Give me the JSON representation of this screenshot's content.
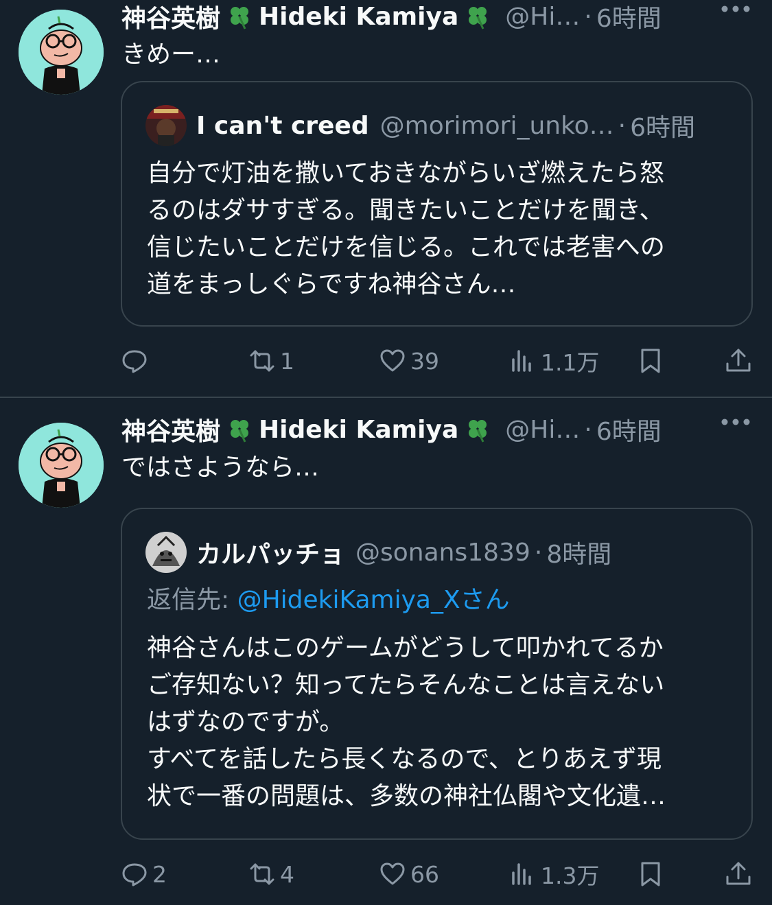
{
  "tweets": [
    {
      "display_name": "神谷英樹",
      "display_name_en": "Hideki Kamiya",
      "handle": "@Hi…",
      "time": "6時間",
      "text": "きめー…",
      "quote": {
        "name": "I can't creed",
        "handle": "@morimori_unko…",
        "time": "6時間",
        "lines": [
          "自分で灯油を撒いておきながらいざ燃えたら怒",
          "るのはダサすぎる。聞きたいことだけを聞き、",
          "信じたいことだけを信じる。これでは老害への",
          "道をまっしぐらですね神谷さん…"
        ]
      },
      "actions": {
        "replies": "",
        "retweets": "1",
        "likes": "39",
        "views": "1.1万"
      }
    },
    {
      "display_name": "神谷英樹",
      "display_name_en": "Hideki Kamiya",
      "handle": "@Hi…",
      "time": "6時間",
      "text": "ではさようなら…",
      "quote": {
        "name": "カルパッチョ",
        "handle": "@sonans1839",
        "time": "8時間",
        "reply_prefix": "返信先: ",
        "reply_target": "@HidekiKamiya_Xさん",
        "lines": [
          "神谷さんはこのゲームがどうして叩かれてるか",
          "ご存知ない？知ってたらそんなことは言えない",
          "はずなのですが。",
          "すべてを話したら長くなるので、とりあえず現",
          "状で一番の問題は、多数の神社仏閣や文化遺…"
        ]
      },
      "actions": {
        "replies": "2",
        "retweets": "4",
        "likes": "66",
        "views": "1.3万"
      }
    }
  ],
  "header_separator": "·",
  "icons": {
    "clover": "four-leaf-clover-emoji",
    "more": "more-dots-icon",
    "reply": "reply-icon",
    "retweet": "retweet-icon",
    "like": "heart-icon",
    "views": "views-chart-icon",
    "bookmark": "bookmark-icon",
    "share": "share-icon"
  },
  "colors": {
    "background": "#15202b",
    "text": "#f7f9f9",
    "muted": "#8b98a5",
    "border": "#38444d",
    "link": "#1d9bf0",
    "clover": "#3fa34d",
    "avatar_bg": "#8fe6dc"
  }
}
